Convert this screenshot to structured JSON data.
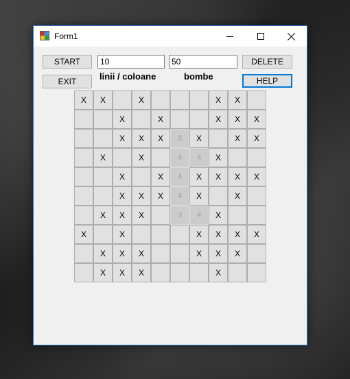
{
  "window": {
    "title": "Form1"
  },
  "toolbar": {
    "start_label": "START",
    "exit_label": "EXIT",
    "delete_label": "DELETE",
    "help_label": "HELP",
    "rows_cols_value": "10",
    "bombs_value": "50",
    "rows_cols_label": "linii / coloane",
    "bombs_label": "bombe"
  },
  "board": {
    "rows": [
      [
        "X",
        "X",
        "",
        "X",
        "",
        "",
        "",
        "X",
        "X",
        ""
      ],
      [
        "",
        "",
        "X",
        "",
        "X",
        "",
        "",
        "X",
        "X",
        "X"
      ],
      [
        "",
        "",
        "X",
        "X",
        "X",
        "3",
        "X",
        "",
        "X",
        "X"
      ],
      [
        "",
        "X",
        "",
        "X",
        "",
        "4",
        "4",
        "X",
        "",
        ""
      ],
      [
        "",
        "",
        "X",
        "",
        "X",
        "4",
        "X",
        "X",
        "X",
        "X"
      ],
      [
        "",
        "",
        "X",
        "X",
        "X",
        "4",
        "X",
        "",
        "X",
        ""
      ],
      [
        "",
        "X",
        "X",
        "X",
        "",
        "3",
        "4",
        "X",
        "",
        ""
      ],
      [
        "X",
        "",
        "X",
        "",
        "",
        "",
        "X",
        "X",
        "X",
        "X"
      ],
      [
        "",
        "X",
        "X",
        "X",
        "",
        "",
        "X",
        "X",
        "X",
        ""
      ],
      [
        "",
        "X",
        "X",
        "X",
        "",
        "",
        "",
        "X",
        "",
        ""
      ]
    ],
    "revealed": [
      [
        2,
        5
      ],
      [
        3,
        5
      ],
      [
        3,
        6
      ],
      [
        4,
        5
      ],
      [
        5,
        5
      ],
      [
        6,
        5
      ],
      [
        6,
        6
      ]
    ]
  }
}
